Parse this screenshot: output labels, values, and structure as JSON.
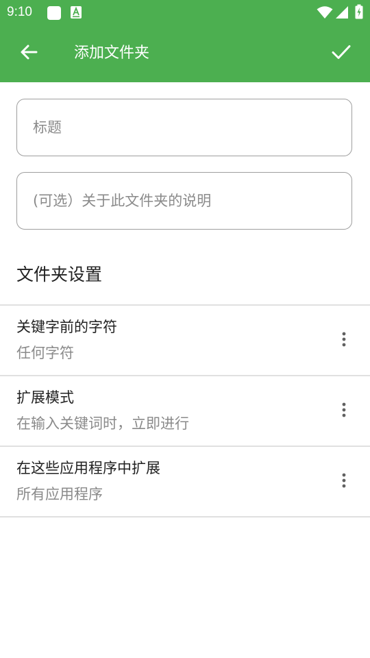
{
  "status_bar": {
    "time": "9:10",
    "icons": [
      "app-notification-icon",
      "accessibility-notification-icon",
      "wifi-icon",
      "cell-signal-icon",
      "battery-icon"
    ]
  },
  "toolbar": {
    "title": "添加文件夹",
    "back_icon": "arrow-back-icon",
    "confirm_icon": "check-icon"
  },
  "form": {
    "title_field": {
      "placeholder": "标题",
      "value": ""
    },
    "description_field": {
      "placeholder": "(可选）关于此文件夹的说明",
      "value": ""
    }
  },
  "settings": {
    "header": "文件夹设置",
    "items": [
      {
        "title": "关键字前的字符",
        "summary": "任何字符",
        "menu_icon": "more-vert-icon"
      },
      {
        "title": "扩展模式",
        "summary": "在输入关键词时，立即进行",
        "menu_icon": "more-vert-icon"
      },
      {
        "title": "在这些应用程序中扩展",
        "summary": "所有应用程序",
        "menu_icon": "more-vert-icon"
      }
    ]
  },
  "colors": {
    "primary": "#4CAF50",
    "on_primary": "#FFFFFF",
    "text_primary": "#212121",
    "text_secondary": "#8A8A8A",
    "divider": "#E0E0E0",
    "field_border": "#9E9E9E"
  }
}
